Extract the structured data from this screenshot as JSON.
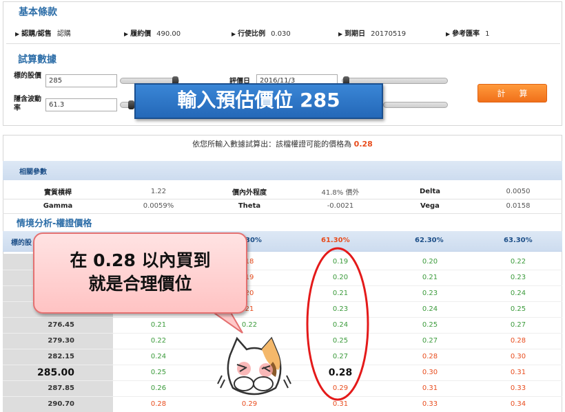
{
  "basic": {
    "title": "基本條款",
    "terms": [
      {
        "label": "認購/認售",
        "value": "認購"
      },
      {
        "label": "履約價",
        "value": "490.00"
      },
      {
        "label": "行使比例",
        "value": "0.030"
      },
      {
        "label": "到期日",
        "value": "20170519"
      },
      {
        "label": "參考匯率",
        "value": "1"
      }
    ]
  },
  "trial": {
    "title": "試算數據",
    "stock_label": "標的股價",
    "stock_value": "285",
    "vol_label": "隱含波動率",
    "vol_value": "61.3",
    "date_label": "評價日",
    "date_value": "2016/11/3",
    "calc_label": "計算",
    "banner": "輸入預估價位 285"
  },
  "result": {
    "prefix": "依您所輸入數據試算出：該檔權證可能的價格為 ",
    "price": "0.28"
  },
  "params": {
    "title": "相關參數",
    "rows": [
      [
        {
          "k": "實質槓桿"
        },
        {
          "v": "1.22"
        },
        {
          "k": "價內外程度"
        },
        {
          "v": "41.8% 價外"
        },
        {
          "k": "Delta"
        },
        {
          "v": "0.0050"
        }
      ],
      [
        {
          "k": "Gamma"
        },
        {
          "v": "0.0059%"
        },
        {
          "k": "Theta"
        },
        {
          "v": "-0.0021"
        },
        {
          "k": "Vega"
        },
        {
          "v": "0.0158"
        }
      ]
    ]
  },
  "scenario": {
    "title": "情境分析-權證價格",
    "header_label": "標的股",
    "vol_headers": [
      "30%",
      "61.30%",
      "62.30%",
      "63.30%"
    ],
    "rows": [
      {
        "price": "",
        "v": [
          "",
          "18",
          "0.19",
          "0.20",
          "0.22"
        ]
      },
      {
        "price": "",
        "v": [
          "",
          "19",
          "0.20",
          "0.21",
          "0.23"
        ]
      },
      {
        "price": "",
        "v": [
          "",
          "20",
          "0.21",
          "0.23",
          "0.24"
        ]
      },
      {
        "price": "",
        "v": [
          "",
          "21",
          "0.23",
          "0.24",
          "0.25"
        ]
      },
      {
        "price": "276.45",
        "v": [
          "0.21",
          "0.22",
          "0.24",
          "0.25",
          "0.27"
        ]
      },
      {
        "price": "279.30",
        "v": [
          "0.22",
          "",
          "0.25",
          "0.27",
          "0.28"
        ]
      },
      {
        "price": "282.15",
        "v": [
          "0.24",
          "",
          "0.27",
          "0.28",
          "0.30"
        ]
      },
      {
        "price": "285.00",
        "v": [
          "0.25",
          "",
          "0.28",
          "0.30",
          "0.31"
        ]
      },
      {
        "price": "287.85",
        "v": [
          "0.26",
          "",
          "0.29",
          "0.31",
          "0.33"
        ]
      },
      {
        "price": "290.70",
        "v": [
          "0.28",
          "0.29",
          "0.31",
          "0.33",
          "0.34"
        ]
      }
    ]
  },
  "callout": {
    "line1": "在 0.28 以內買到",
    "line2": "就是合理價位"
  },
  "colors": {
    "accent_blue": "#2d6ea8",
    "accent_red": "#e84c1d",
    "green": "#3a9a3a",
    "calc_orange": "#f0701a"
  }
}
